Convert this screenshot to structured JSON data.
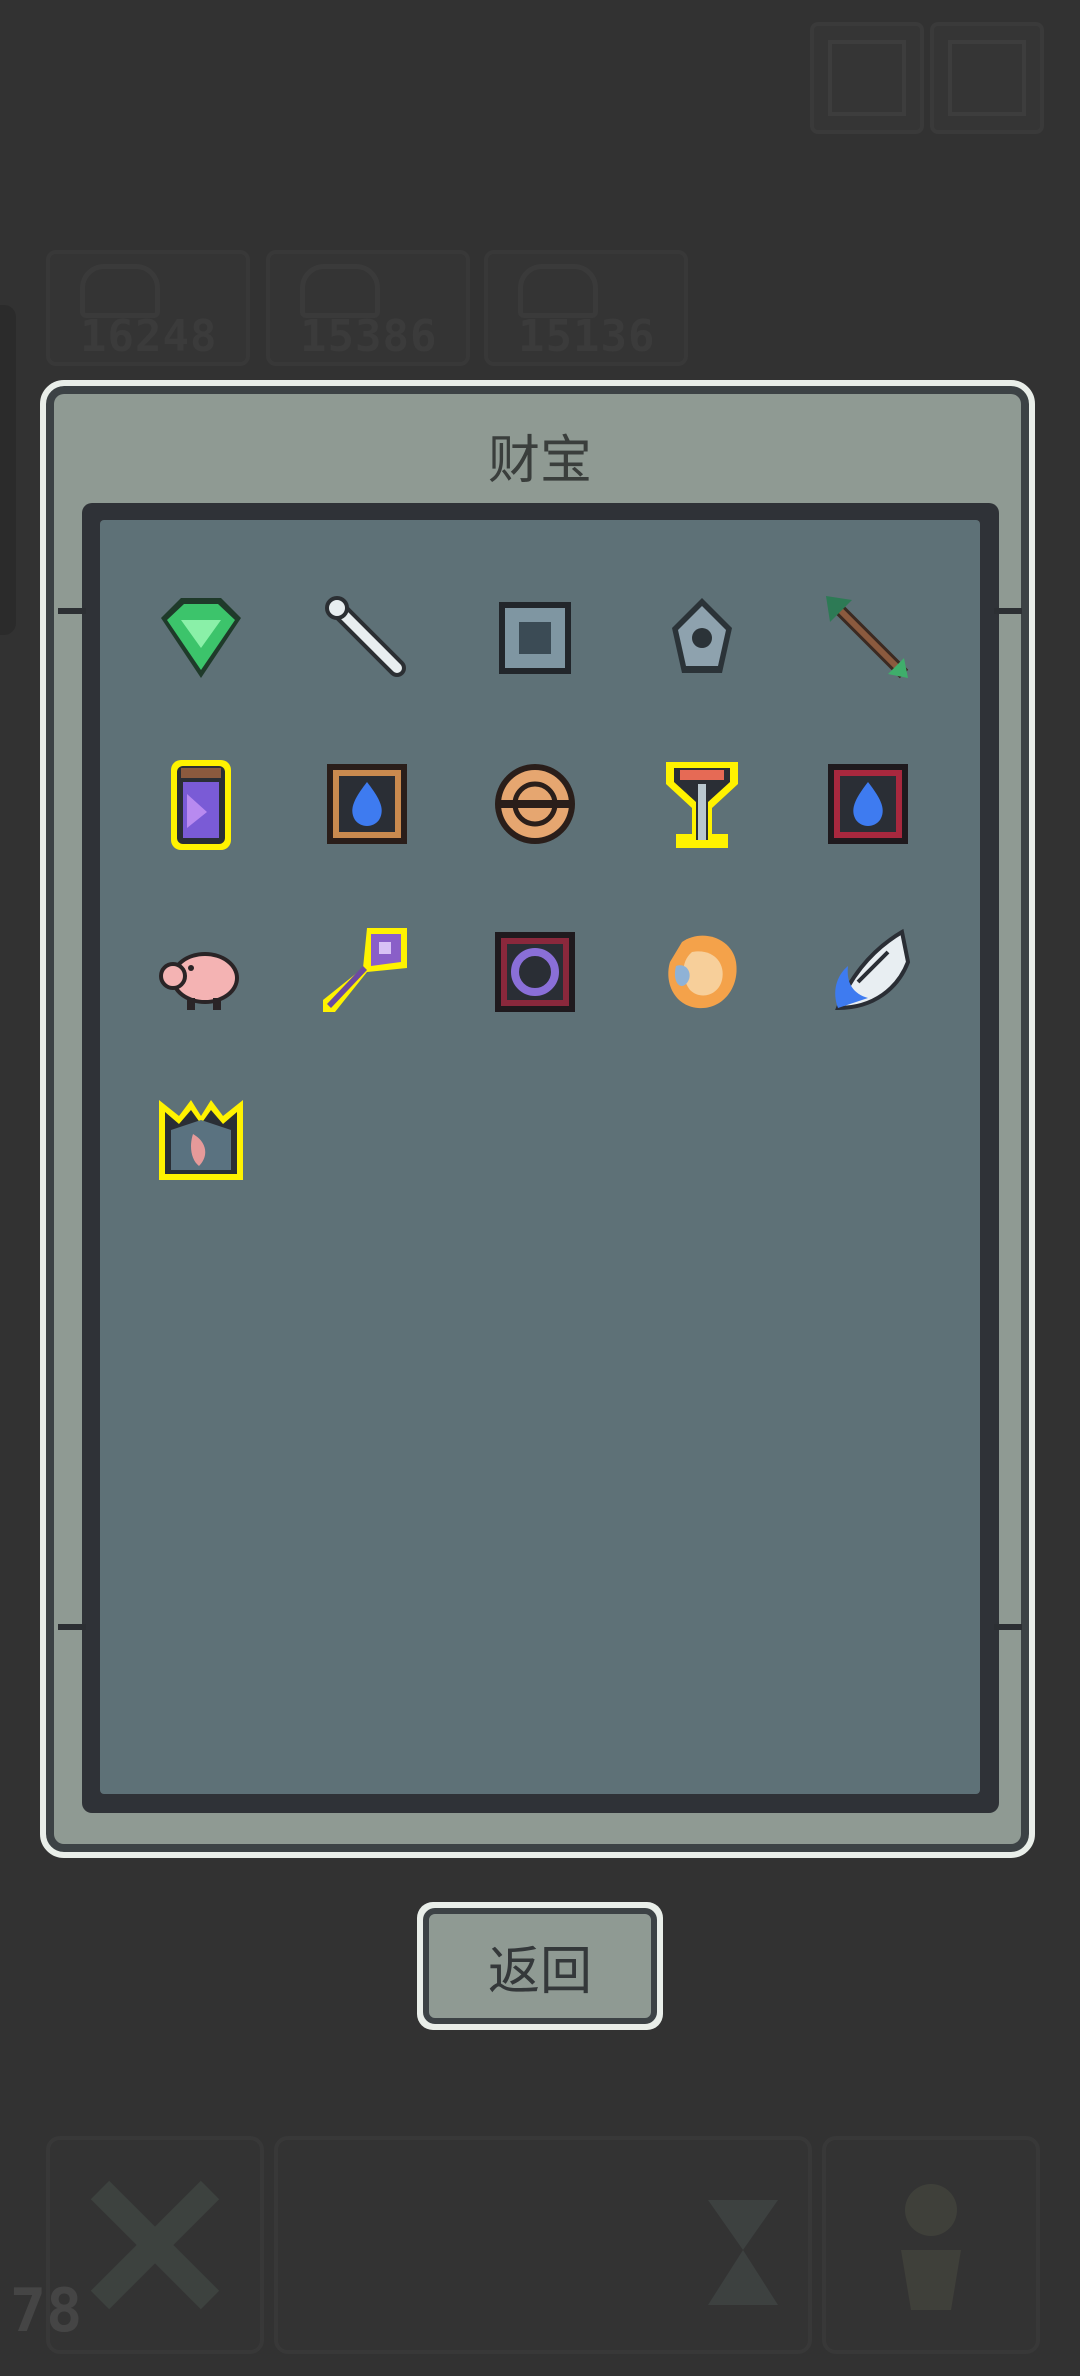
{
  "top_buttons": [
    {
      "icon": "menu-icon"
    },
    {
      "icon": "settings-icon"
    }
  ],
  "resources": [
    {
      "icon": "face-icon",
      "value": "16248"
    },
    {
      "icon": "face-icon",
      "value": "15386"
    },
    {
      "icon": "face-icon",
      "value": "15136"
    }
  ],
  "dialog": {
    "title": "财宝",
    "items": [
      {
        "name": "green-gem-icon"
      },
      {
        "name": "bone-icon"
      },
      {
        "name": "stone-tablet-icon"
      },
      {
        "name": "gear-bat-icon"
      },
      {
        "name": "arrow-icon"
      },
      {
        "name": "potion-jar-icon"
      },
      {
        "name": "water-tome-icon"
      },
      {
        "name": "orb-ring-icon"
      },
      {
        "name": "chalice-icon"
      },
      {
        "name": "blue-flame-tome-icon"
      },
      {
        "name": "pig-icon"
      },
      {
        "name": "purple-key-icon"
      },
      {
        "name": "purple-ring-tome-icon"
      },
      {
        "name": "egg-icon"
      },
      {
        "name": "blue-wing-icon"
      },
      {
        "name": "crown-icon"
      }
    ],
    "back_label": "返回"
  },
  "bottom_bar": {
    "level": "78",
    "slots": [
      {
        "icon": "crossed-swords-icon"
      },
      {
        "icon": "hourglass-icon"
      },
      {
        "icon": "pawn-icon"
      }
    ]
  }
}
